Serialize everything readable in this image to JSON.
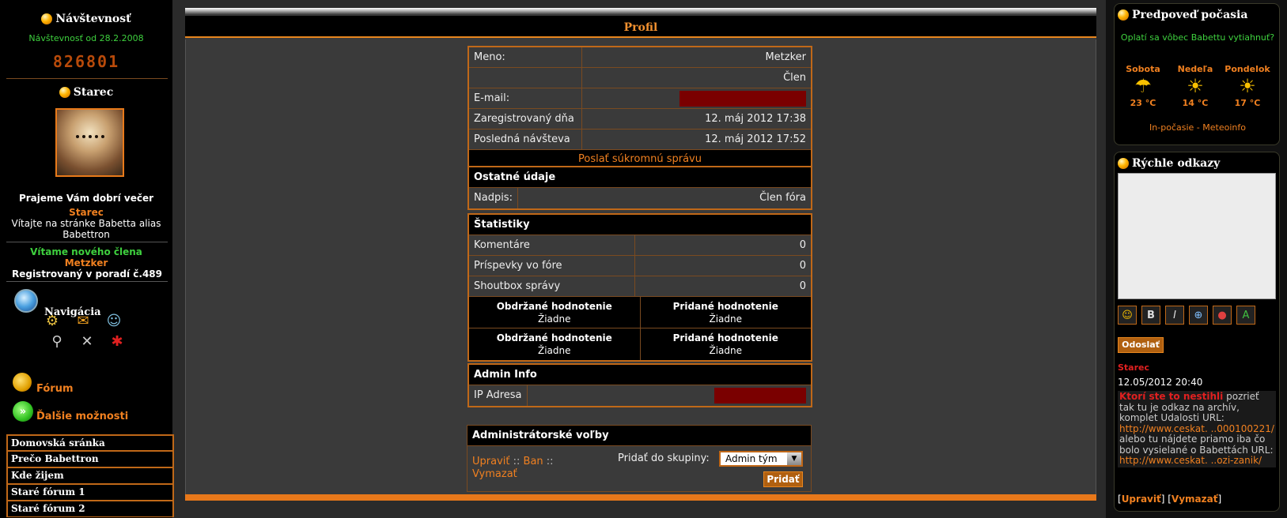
{
  "left": {
    "visits_title": "Návštevnosť",
    "visits_since": "Návštevnosť od 28.2.2008",
    "visits_counter": "826801",
    "user_title": "Starec",
    "greeting": "Prajeme Vám dobrí večer",
    "greeting_name": "Starec",
    "welcome": "Vítajte na stránke Babetta alias Babettron",
    "new_member_label": "Vítame nového člena",
    "new_member_name": "Metzker",
    "registered_order": "Registrovaný v poradí č.489",
    "nav_title": "Navigácia",
    "forum_link": "Fórum",
    "more_link": "Ďalšie možnosti",
    "menu": [
      "Domovská sránka",
      "Prečo Babettron",
      "Kde žijem",
      "Staré fórum 1",
      "Staré fórum 2"
    ]
  },
  "main": {
    "title": "Profil",
    "profile": {
      "name_label": "Meno:",
      "name_value": "Metzker",
      "role_value": "Člen",
      "email_label": "E-mail:",
      "registered_label": "Zaregistrovaný dňa",
      "registered_value": "12. máj 2012 17:38",
      "last_visit_label": "Posledná návšteva",
      "last_visit_value": "12. máj 2012 17:52",
      "send_pm": "Poslať súkromnú správu"
    },
    "other": {
      "head": "Ostatné údaje",
      "title_label": "Nadpis:",
      "title_value": "Člen fóra"
    },
    "stats": {
      "head": "Štatistiky",
      "comments_label": "Komentáre",
      "comments_value": "0",
      "forum_posts_label": "Príspevky vo fóre",
      "forum_posts_value": "0",
      "shoutbox_label": "Shoutbox správy",
      "shoutbox_value": "0",
      "received_rating_label": "Obdržané hodnotenie",
      "given_rating_label": "Pridané hodnotenie",
      "rating_none": "Žiadne"
    },
    "admin_info": {
      "head": "Admin Info",
      "ip_label": "IP Adresa"
    },
    "admin_options": {
      "head": "Administrátorské voľby",
      "edit": "Upraviť",
      "ban": "Ban",
      "delete": "Vymazať",
      "sep": "::",
      "group_label": "Pridať do skupiny:",
      "group_selected": "Admin tým",
      "add_button": "Pridať"
    }
  },
  "right": {
    "weather_title": "Predpoveď počasia",
    "weather_question": "Oplatí sa vôbec Babettu vytiahnuť?",
    "days": [
      {
        "name": "Sobota",
        "temp": "23 °C",
        "icon": "sun-rain-icon"
      },
      {
        "name": "Nedeľa",
        "temp": "14 °C",
        "icon": "sun-cloud-icon"
      },
      {
        "name": "Pondelok",
        "temp": "17 °C",
        "icon": "sun-cloud-icon"
      }
    ],
    "weather_source": "In-počasie - Meteoinfo",
    "quick_title": "Rýchle odkazy",
    "send_button": "Odoslať",
    "shout_author": "Starec",
    "shout_date": "12.05/2012 20:40",
    "shout_highlight": "Ktorí ste to nestihli",
    "shout_text_1": " pozrieť tak tu je odkaz na archív, komplet Udalosti URL: ",
    "shout_link_1": "http://www.ceskat. ..000100221/",
    "shout_text_2": " alebo tu nájdete priamo iba čo bolo vysielané o Babettách URL: ",
    "shout_link_2": "http://www.ceskat. ..ozi-zanik/",
    "shout_edit": "Upraviť",
    "shout_delete": "Vymazať"
  },
  "colors": {
    "accent": "#e8861e",
    "link": "#f08020",
    "green": "#3ed03e",
    "redacted": "#7a0000"
  }
}
